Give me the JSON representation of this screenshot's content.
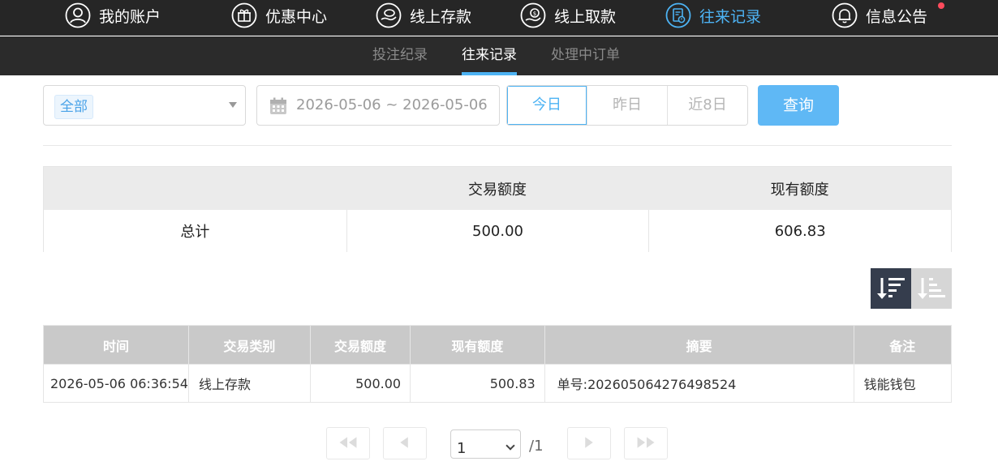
{
  "nav": {
    "items": [
      {
        "label": "我的账户",
        "icon": "user-icon"
      },
      {
        "label": "优惠中心",
        "icon": "gift-icon"
      },
      {
        "label": "线上存款",
        "icon": "deposit-icon"
      },
      {
        "label": "线上取款",
        "icon": "withdraw-icon"
      },
      {
        "label": "往来记录",
        "icon": "records-icon",
        "active": true
      },
      {
        "label": "信息公告",
        "icon": "bell-icon"
      }
    ],
    "accent_color": "#4db3f4",
    "notification_dot_color": "#ff4b5c"
  },
  "subnav": {
    "items": [
      {
        "label": "投注纪录"
      },
      {
        "label": "往来记录",
        "active": true
      },
      {
        "label": "处理中订单"
      }
    ]
  },
  "filters": {
    "type_select_value": "全部",
    "date_range": "2026-05-06 ~ 2026-05-06",
    "quick_dates": [
      "今日",
      "昨日",
      "近8日"
    ],
    "quick_date_selected": "今日",
    "query_label": "查询"
  },
  "summary": {
    "headers": [
      "",
      "交易额度",
      "现有额度"
    ],
    "row": {
      "label": "总计",
      "amount": "500.00",
      "balance": "606.83"
    }
  },
  "sort": {
    "desc_icon": "sort-desc-icon",
    "asc_icon": "sort-asc-icon",
    "selected": "desc"
  },
  "table": {
    "columns": [
      "时间",
      "交易类别",
      "交易额度",
      "现有额度",
      "摘要",
      "备注"
    ],
    "rows": [
      {
        "time": "2026-05-06 06:36:54",
        "type": "线上存款",
        "amount": "500.00",
        "balance": "500.83",
        "summary": "单号:202605064276498524",
        "note": "钱能钱包"
      }
    ]
  },
  "pagination": {
    "first_icon": "first-page-icon",
    "prev_icon": "prev-page-icon",
    "next_icon": "next-page-icon",
    "last_icon": "last-page-icon",
    "current_page": "1",
    "total_pages": "/1"
  }
}
